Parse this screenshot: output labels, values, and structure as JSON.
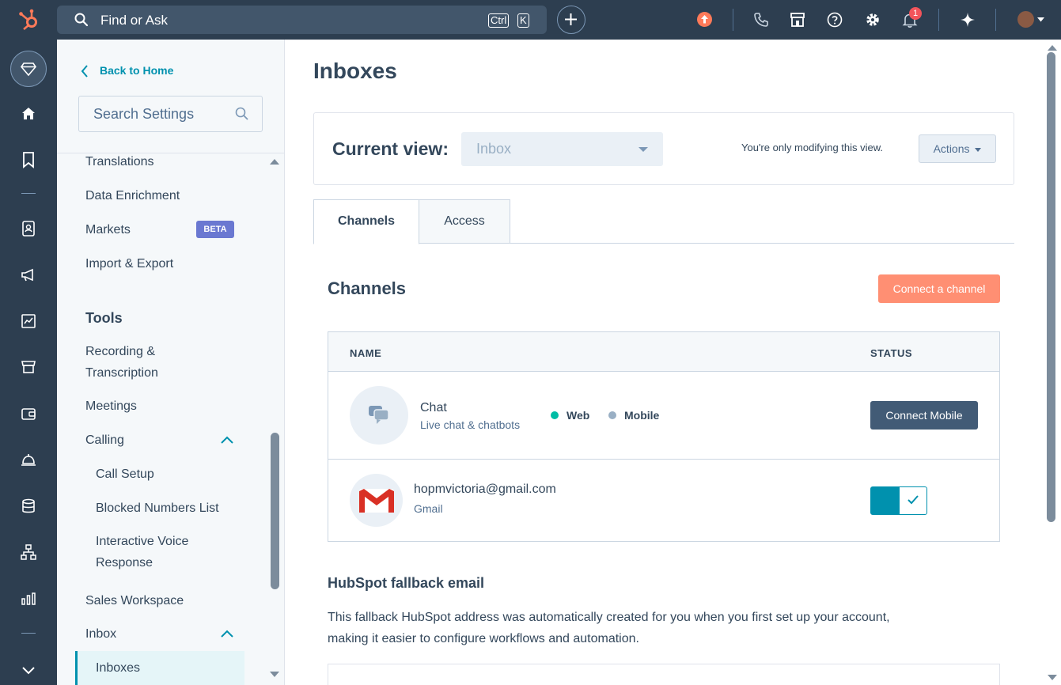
{
  "topbar": {
    "search_placeholder": "Find or Ask",
    "shortcut_ctrl": "Ctrl",
    "shortcut_key": "K",
    "notification_count": "1"
  },
  "sidebar": {
    "back_label": "Back to Home",
    "search_placeholder": "Search Settings",
    "items": {
      "translations": "Translations",
      "data_enrichment": "Data Enrichment",
      "markets": "Markets",
      "markets_badge": "BETA",
      "import_export": "Import & Export",
      "tools_heading": "Tools",
      "recording_line1": "Recording &",
      "recording_line2": "Transcription",
      "meetings": "Meetings",
      "calling": "Calling",
      "call_setup": "Call Setup",
      "blocked_numbers": "Blocked Numbers List",
      "ivr_line1": "Interactive Voice",
      "ivr_line2": "Response",
      "sales_workspace": "Sales Workspace",
      "inbox": "Inbox",
      "inboxes": "Inboxes"
    }
  },
  "main": {
    "title": "Inboxes",
    "current_view_label": "Current view:",
    "current_view_value": "Inbox",
    "modify_note": "You're only modifying this view.",
    "actions_label": "Actions",
    "tabs": [
      {
        "label": "Channels"
      },
      {
        "label": "Access"
      }
    ],
    "channels_heading": "Channels",
    "connect_label": "Connect a channel",
    "table": {
      "col_name": "NAME",
      "col_status": "STATUS",
      "rows": [
        {
          "name": "Chat",
          "sub": "Live chat & chatbots",
          "web": "Web",
          "mobile": "Mobile",
          "action": "Connect Mobile"
        },
        {
          "name": "hopmvictoria@gmail.com",
          "sub": "Gmail",
          "enabled": true
        }
      ]
    },
    "fallback_heading": "HubSpot fallback email",
    "fallback_text": "This fallback HubSpot address was automatically created for you when you first set up your account, making it easier to configure workflows and automation."
  },
  "colors": {
    "topbar": "#2d3e50",
    "accent": "#0091ae",
    "primary_button": "#ff8f73",
    "web_status": "#00bda5",
    "mobile_status": "#99afc4"
  },
  "icons": {
    "search": "search-icon",
    "plus": "plus-icon",
    "upgrade": "upgrade-arrow-icon",
    "phone": "phone-icon",
    "marketplace": "marketplace-icon",
    "help": "help-icon",
    "settings": "gear-icon",
    "notifications": "bell-icon",
    "ai": "sparkle-icon"
  }
}
